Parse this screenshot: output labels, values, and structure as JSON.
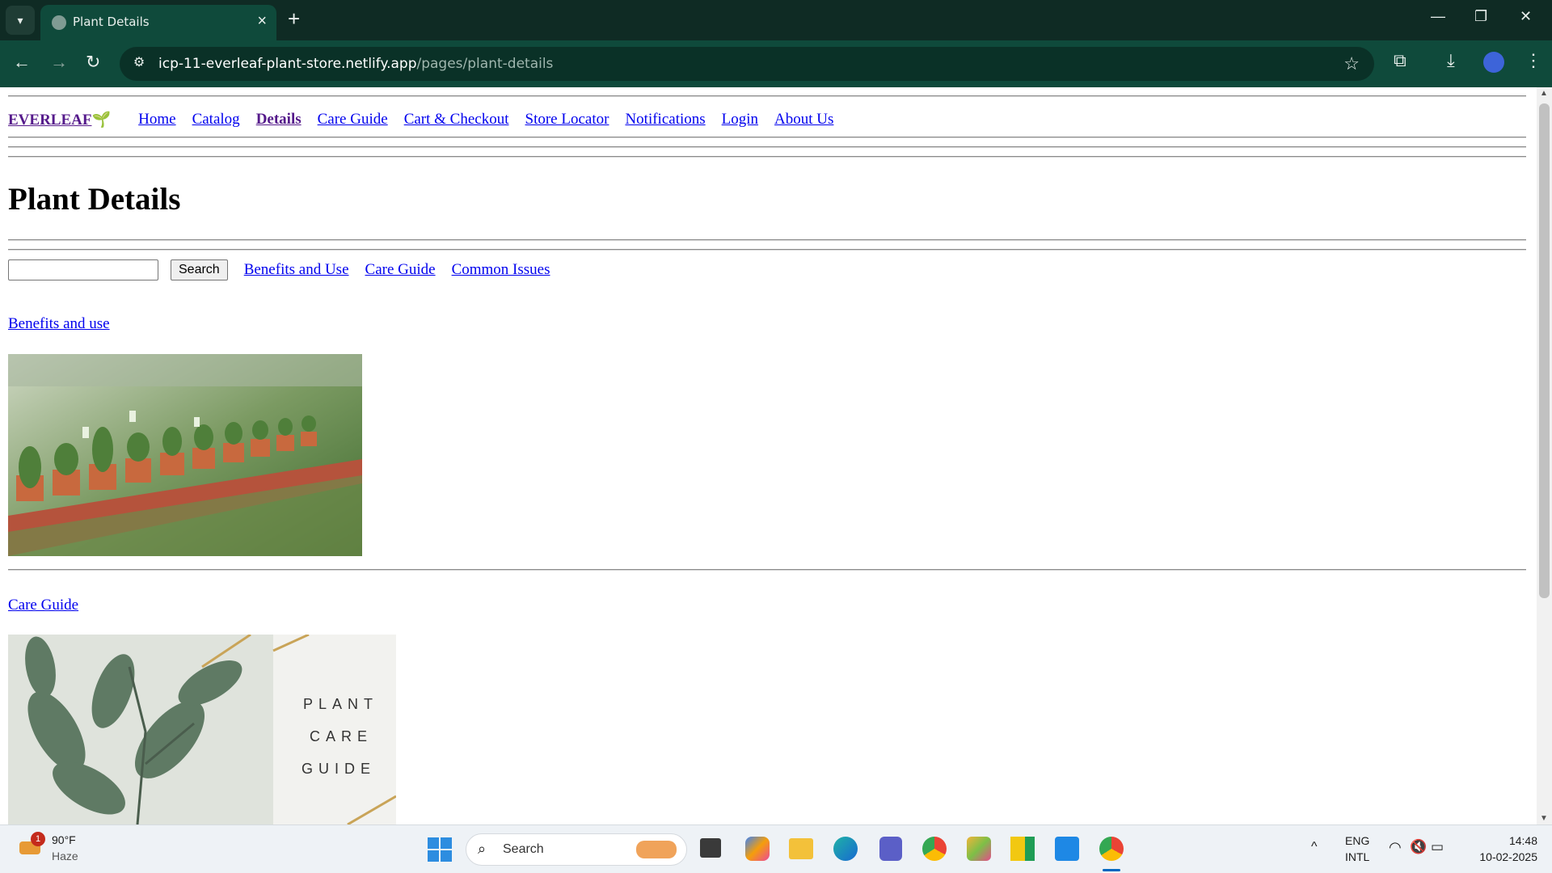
{
  "browser": {
    "tab_title": "Plant Details",
    "url_host": "icp-11-everleaf-plant-store.netlify.app",
    "url_path": "/pages/plant-details"
  },
  "site": {
    "brand": "EVERLEAF",
    "nav": [
      "Home",
      "Catalog",
      "Details",
      "Care Guide",
      "Cart & Checkout",
      "Store Locator",
      "Notifications",
      "Login",
      "About Us"
    ],
    "active_nav": "Details"
  },
  "page": {
    "title": "Plant Details",
    "search_button": "Search",
    "search_value": "",
    "subnav": [
      "Benefits and Use",
      "Care Guide",
      "Common Issues"
    ],
    "sections": [
      {
        "link": "Benefits and use"
      },
      {
        "link": "Care Guide",
        "image_text": [
          "PLANT",
          "CARE",
          "GUIDE"
        ]
      }
    ]
  },
  "taskbar": {
    "weather_temp": "90°F",
    "weather_desc": "Haze",
    "weather_badge": "1",
    "search_label": "Search",
    "lang_1": "ENG",
    "lang_2": "INTL",
    "time": "14:48",
    "date": "10-02-2025"
  },
  "colors": {
    "chrome_dark": "#0f2b24",
    "chrome_toolbar": "#0f4a3b",
    "link": "#0000ee",
    "visited": "#551a8b"
  }
}
